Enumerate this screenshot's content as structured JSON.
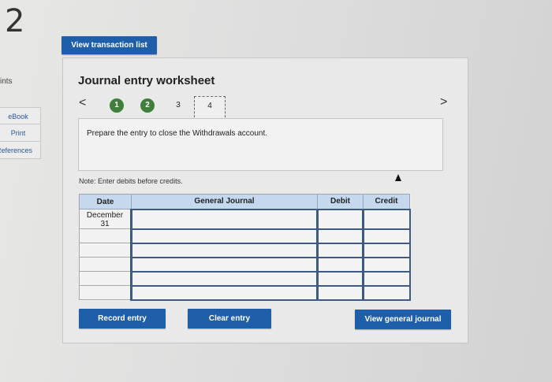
{
  "question": {
    "number": "2",
    "points_label": "ints"
  },
  "sidebar": {
    "links": [
      {
        "label": "eBook"
      },
      {
        "label": "Print"
      },
      {
        "label": "References"
      }
    ]
  },
  "top_button": {
    "label": "View transaction list"
  },
  "worksheet": {
    "title": "Journal entry worksheet",
    "nav_prev": "<",
    "nav_next": ">",
    "steps": [
      {
        "label": "1"
      },
      {
        "label": "2"
      },
      {
        "label": "3"
      },
      {
        "label": "4"
      }
    ],
    "instruction": "Prepare the entry to close the Withdrawals account.",
    "note": "Note: Enter debits before credits."
  },
  "journal": {
    "headers": {
      "date": "Date",
      "general_journal": "General Journal",
      "debit": "Debit",
      "credit": "Credit"
    },
    "first_row_date": {
      "month": "December",
      "day": "31"
    }
  },
  "buttons": {
    "record": "Record entry",
    "clear": "Clear entry",
    "view_general_journal": "View general journal"
  },
  "colors": {
    "button_blue": "#1f5ea8",
    "step_done_green": "#3f7f3a",
    "table_header": "#c6d8ee"
  }
}
